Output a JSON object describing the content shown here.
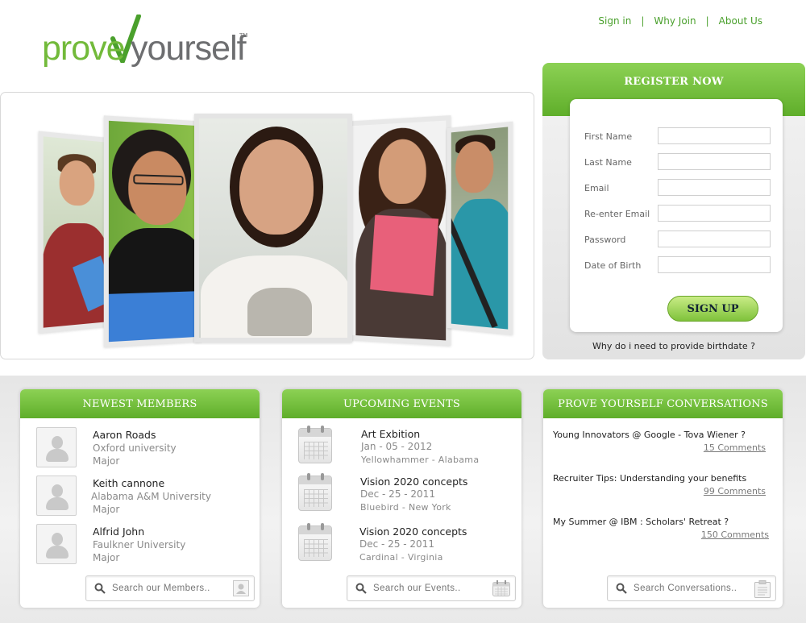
{
  "brand": {
    "logo_prove": "prove",
    "logo_yourself": "yourself",
    "logo_tm": "TM"
  },
  "nav": {
    "items": [
      {
        "label": "Sign in"
      },
      {
        "label": "Why Join"
      },
      {
        "label": "About Us"
      }
    ],
    "separator": "|"
  },
  "register": {
    "title": "REGISTER NOW",
    "fields": [
      {
        "label": "First Name",
        "value": ""
      },
      {
        "label": "Last Name",
        "value": ""
      },
      {
        "label": "Email",
        "value": ""
      },
      {
        "label": "Re-enter Email",
        "value": ""
      },
      {
        "label": "Password",
        "value": ""
      },
      {
        "label": "Date of Birth",
        "value": ""
      }
    ],
    "submit_label": "SIGN UP",
    "birthdate_link": "Why do i need to provide birthdate ?"
  },
  "members": {
    "title": "NEWEST  MEMBERS",
    "items": [
      {
        "name": "Aaron Roads",
        "school": "Oxford university",
        "major": "Major"
      },
      {
        "name": "Keith cannone",
        "school": "Alabama A&M University",
        "major": "Major"
      },
      {
        "name": "Alfrid John",
        "school": "Faulkner University",
        "major": "Major"
      }
    ],
    "search_placeholder": "Search our Members.."
  },
  "events": {
    "title": "UPCOMING  EVENTS",
    "items": [
      {
        "name": "Art Exbition",
        "date": "Jan - 05 - 2012",
        "location": "Yellowhammer - Alabama"
      },
      {
        "name": "Vision 2020 concepts",
        "date": "Dec - 25 - 2011",
        "location": "Bluebird - New York"
      },
      {
        "name": "Vision 2020 concepts",
        "date": "Dec - 25 - 2011",
        "location": "Cardinal - Virginia"
      }
    ],
    "search_placeholder": "Search our Events.."
  },
  "conversations": {
    "title": "PROVE YOURSELF CONVERSATIONS",
    "items": [
      {
        "title": "Young Innovators @ Google - Tova Wiener ?",
        "comments": "15 Comments"
      },
      {
        "title": "Recruiter Tips: Understanding your benefits",
        "comments": "99 Comments"
      },
      {
        "title": "My Summer @ IBM : Scholars' Retreat ?",
        "comments": "150 Comments"
      }
    ],
    "search_placeholder": "Search Conversations.."
  },
  "colors": {
    "accent_green": "#72ba3a",
    "header_green_top": "#8cd154",
    "header_green_bottom": "#5fae2a"
  }
}
